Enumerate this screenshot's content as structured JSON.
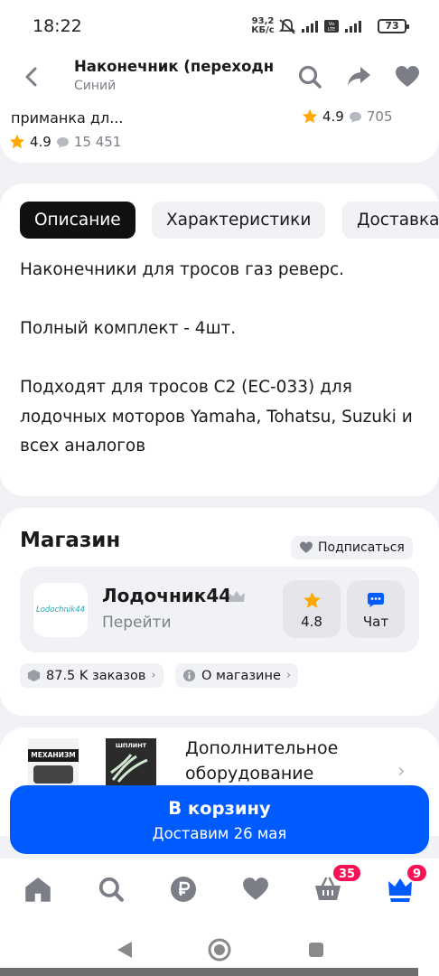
{
  "status_bar": {
    "time": "18:22",
    "net_speed_value": "93,2",
    "net_speed_unit": "КБ/с",
    "battery": "73"
  },
  "header": {
    "title": "Наконечник (переходн",
    "subtitle": "Синий"
  },
  "similar_item": {
    "name": "приманка дл...",
    "left_rating": "4.9",
    "left_reviews": "15 451",
    "right_rating": "4.9",
    "right_reviews": "705"
  },
  "tabs": [
    {
      "label": "Описание",
      "active": true
    },
    {
      "label": "Характеристики",
      "active": false
    },
    {
      "label": "Доставка",
      "active": false
    }
  ],
  "description": "Наконечники для тросов газ реверс.\n\nПолный комплект - 4шт.\n\nПодходят для тросов С2 (ЕС-033) для лодочных моторов Yamaha, Tohatsu, Suzuki и всех аналогов",
  "shop": {
    "section_title": "Магазин",
    "subscribe_label": "Подписаться",
    "logo_text": "Lodochnik44",
    "name": "Лодочник44",
    "go_label": "Перейти",
    "rating": "4.8",
    "chat_label": "Чат",
    "orders_label": "87.5 K заказов",
    "about_label": "О магазине"
  },
  "extra": {
    "thumb1_text": "МЕХАНИЗМ",
    "thumb2_text": "ШПЛИНТ",
    "label": "Дополнительное оборудование"
  },
  "cart": {
    "label": "В корзину",
    "delivery": "Доставим 26 мая"
  },
  "bottom_nav": {
    "cart_badge": "35",
    "profile_badge": "9"
  },
  "colors": {
    "accent_blue": "#005bff",
    "badge_pink": "#f91155",
    "star_orange": "#ffa800"
  }
}
